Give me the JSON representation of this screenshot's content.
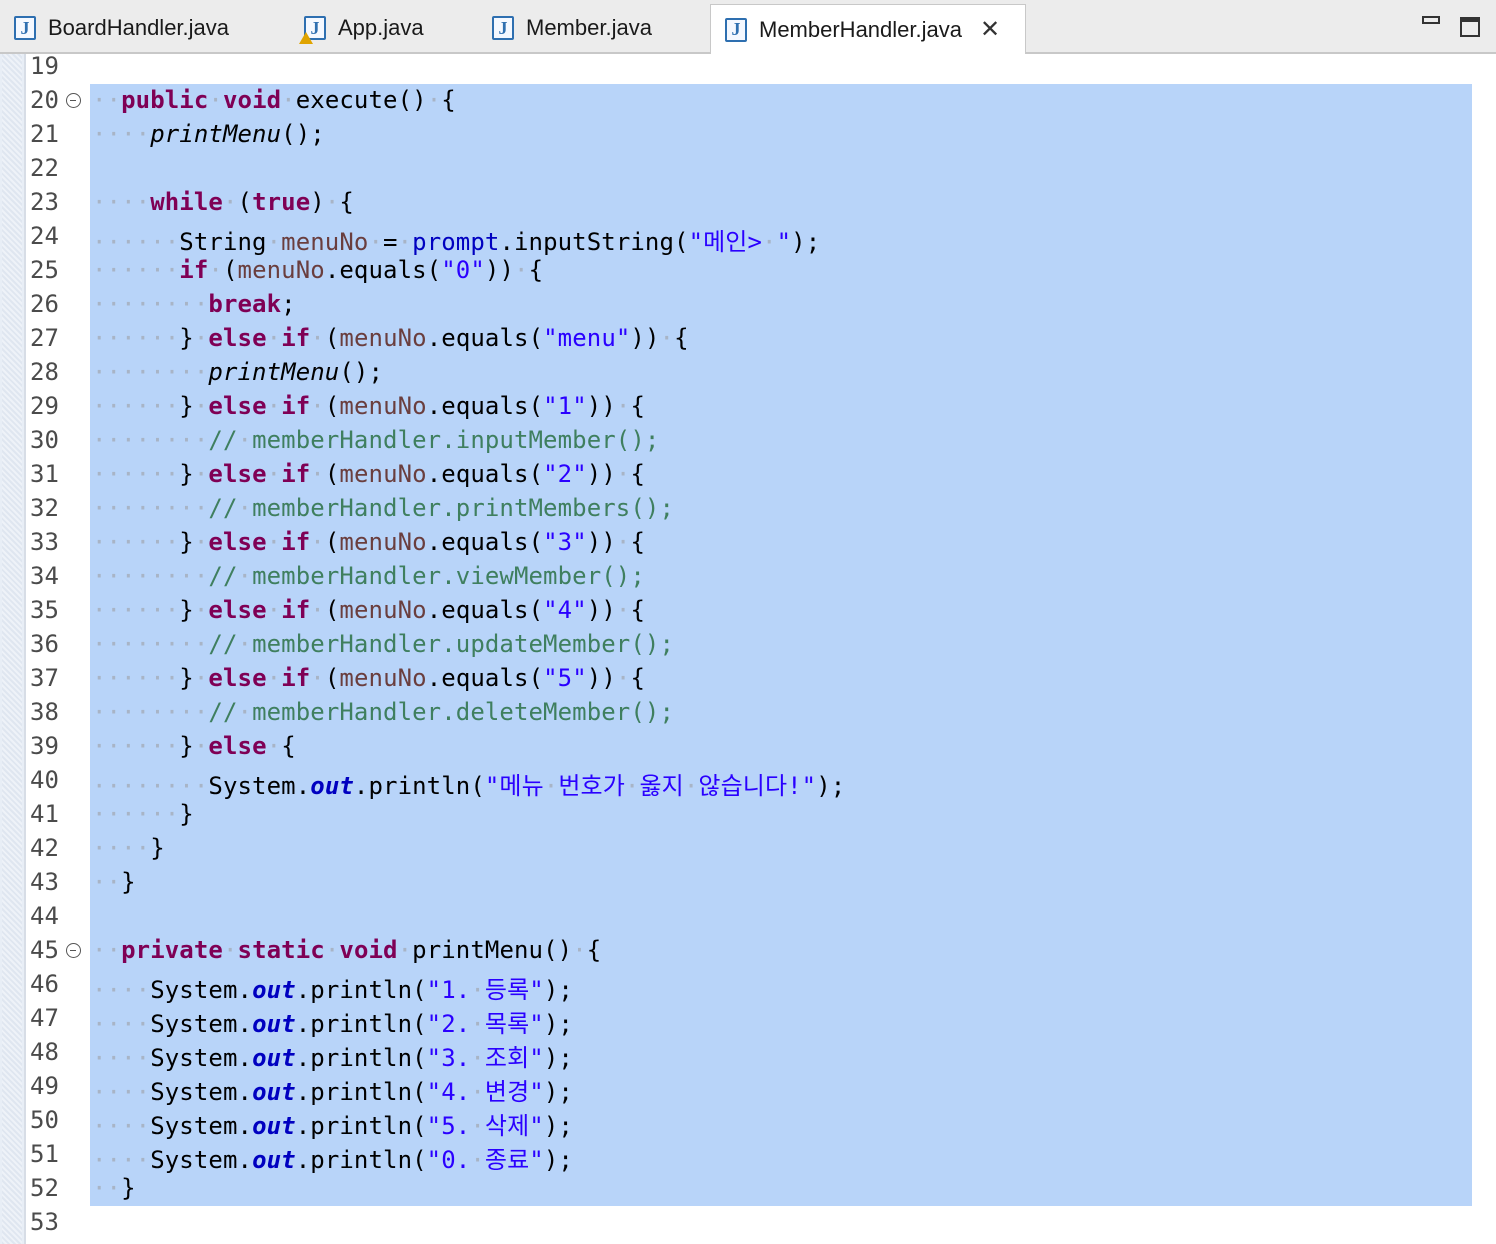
{
  "tabs": [
    {
      "label": "BoardHandler.java",
      "icon": "java-file-icon",
      "active": false
    },
    {
      "label": "App.java",
      "icon": "java-file-warning-icon",
      "active": false
    },
    {
      "label": "Member.java",
      "icon": "java-file-icon",
      "active": false
    },
    {
      "label": "MemberHandler.java",
      "icon": "java-file-icon",
      "active": true
    }
  ],
  "editor": {
    "selection_color": "#b8d4f9",
    "lines": [
      {
        "num": "19",
        "text": ""
      },
      {
        "num": "20",
        "text": "public void execute() {",
        "fold": true
      },
      {
        "num": "21",
        "text": "printMenu();"
      },
      {
        "num": "22",
        "text": ""
      },
      {
        "num": "23",
        "text": "while (true) {"
      },
      {
        "num": "24",
        "text": "String menuNo = prompt.inputString(\"메인> \");"
      },
      {
        "num": "25",
        "text": "if (menuNo.equals(\"0\")) {"
      },
      {
        "num": "26",
        "text": "break;"
      },
      {
        "num": "27",
        "text": "} else if (menuNo.equals(\"menu\")) {"
      },
      {
        "num": "28",
        "text": "printMenu();"
      },
      {
        "num": "29",
        "text": "} else if (menuNo.equals(\"1\")) {"
      },
      {
        "num": "30",
        "text": "// memberHandler.inputMember();"
      },
      {
        "num": "31",
        "text": "} else if (menuNo.equals(\"2\")) {"
      },
      {
        "num": "32",
        "text": "// memberHandler.printMembers();"
      },
      {
        "num": "33",
        "text": "} else if (menuNo.equals(\"3\")) {"
      },
      {
        "num": "34",
        "text": "// memberHandler.viewMember();"
      },
      {
        "num": "35",
        "text": "} else if (menuNo.equals(\"4\")) {"
      },
      {
        "num": "36",
        "text": "// memberHandler.updateMember();"
      },
      {
        "num": "37",
        "text": "} else if (menuNo.equals(\"5\")) {"
      },
      {
        "num": "38",
        "text": "// memberHandler.deleteMember();"
      },
      {
        "num": "39",
        "text": "} else {"
      },
      {
        "num": "40",
        "text": "System.out.println(\"메뉴 번호가 옳지 않습니다!\");"
      },
      {
        "num": "41",
        "text": "}"
      },
      {
        "num": "42",
        "text": "}"
      },
      {
        "num": "43",
        "text": "}"
      },
      {
        "num": "44",
        "text": ""
      },
      {
        "num": "45",
        "text": "private static void printMenu() {",
        "fold": true
      },
      {
        "num": "46",
        "text": "System.out.println(\"1. 등록\");"
      },
      {
        "num": "47",
        "text": "System.out.println(\"2. 목록\");"
      },
      {
        "num": "48",
        "text": "System.out.println(\"3. 조회\");"
      },
      {
        "num": "49",
        "text": "System.out.println(\"4. 변경\");"
      },
      {
        "num": "50",
        "text": "System.out.println(\"5. 삭제\");"
      },
      {
        "num": "51",
        "text": "System.out.println(\"0. 종료\");"
      },
      {
        "num": "52",
        "text": "}"
      },
      {
        "num": "53",
        "text": ""
      }
    ]
  }
}
